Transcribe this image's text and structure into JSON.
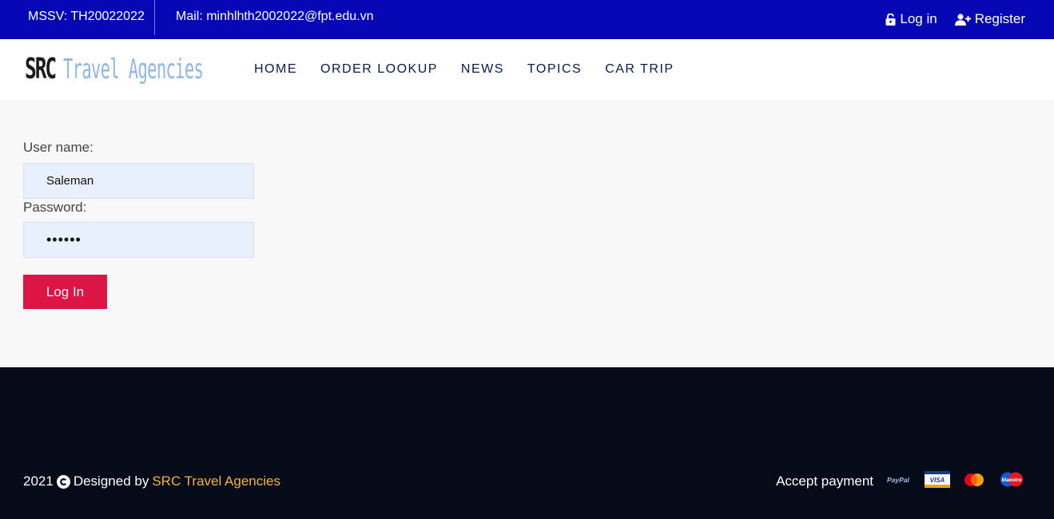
{
  "topbar": {
    "mssv": "MSSV: TH20022022",
    "mail": "Mail: minhlhth2002022@fpt.edu.vn",
    "login_label": "Log in",
    "register_label": "Register"
  },
  "navbar": {
    "logo_primary": "SRC",
    "logo_secondary": "Travel Agencies",
    "menu": [
      "HOME",
      "ORDER LOOKUP",
      "NEWS",
      "TOPICS",
      "CAR TRIP"
    ]
  },
  "form": {
    "username_label": "User name:",
    "username_value": "Saleman",
    "password_label": "Password:",
    "password_value": "••••••",
    "submit_label": "Log In"
  },
  "footer": {
    "year": "2021",
    "designed_by": "Designed by",
    "brand": "SRC Travel Agencies",
    "accept_payment": "Accept payment",
    "payment_methods": [
      "paypal-icon",
      "visa-icon",
      "mastercard-icon",
      "maestro-icon"
    ],
    "payment_card_text": {
      "paypal": "PayPal",
      "visa": "VISA",
      "maestro": "Maestro"
    }
  },
  "colors": {
    "topbar_bg": "#0606b4",
    "button_bg": "#dc1546",
    "footer_bg": "#060b19",
    "brand_accent": "#f2b53a"
  }
}
